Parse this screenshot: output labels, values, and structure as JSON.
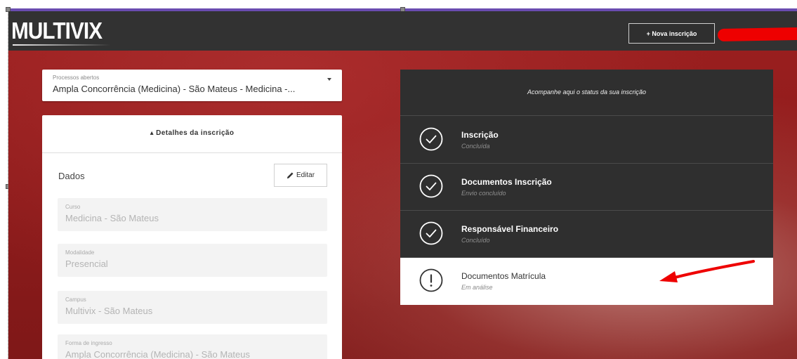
{
  "header": {
    "logo_text": "MULTIVIX",
    "new_button_label": "+ Nova inscrição"
  },
  "selector": {
    "label": "Processos abertos",
    "value": "Ampla Concorrência (Medicina) - São Mateus - Medicina -..."
  },
  "details": {
    "title": "▴ Detalhes da inscrição",
    "section_label": "Dados",
    "edit_label": "Editar",
    "fields": [
      {
        "label": "Curso",
        "value": "Medicina - São Mateus"
      },
      {
        "label": "Modalidade",
        "value": "Presencial"
      },
      {
        "label": "Campus",
        "value": "Multivix - São Mateus"
      },
      {
        "label": "Forma de ingresso",
        "value": "Ampla Concorrência (Medicina) - São Mateus"
      }
    ]
  },
  "status": {
    "title": "Acompanhe aqui o status da sua inscrição",
    "steps": [
      {
        "title": "Inscrição",
        "subtitle": "Concluída",
        "icon": "check-circle-icon"
      },
      {
        "title": "Documentos Inscrição",
        "subtitle": "Envio concluído",
        "icon": "check-circle-icon"
      },
      {
        "title": "Responsável Financeiro",
        "subtitle": "Concluído",
        "icon": "check-circle-icon"
      },
      {
        "title": "Documentos Matrícula",
        "subtitle": "Em análise",
        "icon": "alert-circle-icon"
      }
    ]
  },
  "colors": {
    "topbar": "#323232",
    "brand_red_background": "#9c1f1f",
    "selection_purple": "#6a4cb0",
    "annotation_red": "#ee0000"
  }
}
